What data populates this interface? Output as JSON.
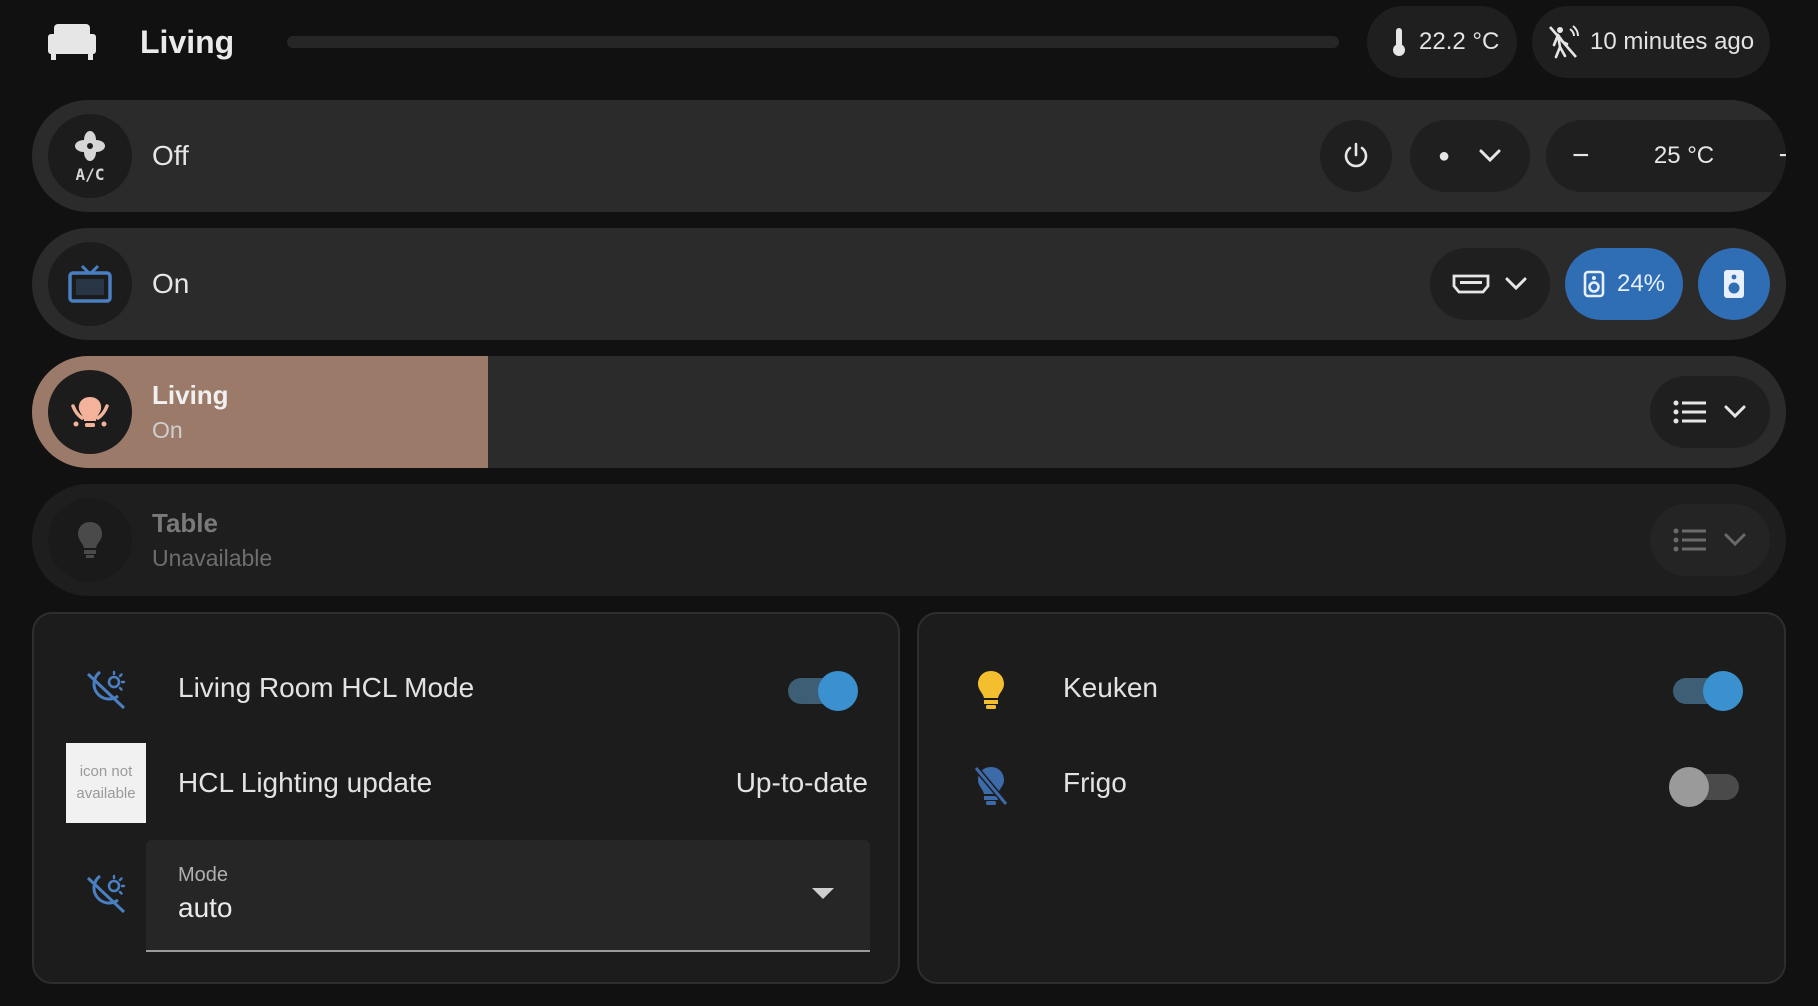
{
  "header": {
    "room_title": "Living",
    "room_icon": "sofa-icon",
    "temperature": "22.2 °C",
    "motion": "10 minutes ago"
  },
  "ac": {
    "state": "Off",
    "icon": "air-conditioner-icon",
    "mode_dot": "●",
    "target_temp": "25 °C",
    "minus": "−",
    "plus": "+"
  },
  "tv": {
    "state": "On",
    "icon": "television-icon",
    "volume": "24%",
    "accent": "#2f6db5"
  },
  "living_light": {
    "name": "Living",
    "state": "On",
    "brightness": 0.26,
    "accent": "#9c7a6a"
  },
  "table_light": {
    "name": "Table",
    "state": "Unavailable"
  },
  "left_card": {
    "hcl_mode_name": "Living Room HCL Mode",
    "hcl_mode_on": true,
    "update_name": "HCL Lighting update",
    "update_state": "Up-to-date",
    "icon_missing_text": "icon not available",
    "mode_label": "Mode",
    "mode_value": "auto"
  },
  "right_card": {
    "keuken_name": "Keuken",
    "keuken_on": true,
    "frigo_name": "Frigo",
    "frigo_on": false
  },
  "colors": {
    "toggle_on": "#3b91cf",
    "icon_blue": "#4a7fc1",
    "bulb_yellow": "#f4bf2f"
  }
}
